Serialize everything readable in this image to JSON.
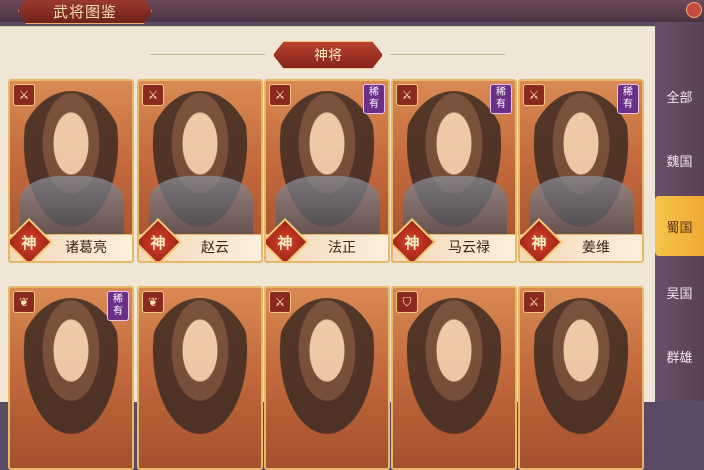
{
  "header": {
    "title": "武将图鉴"
  },
  "section": {
    "title": "神将"
  },
  "tabs": [
    {
      "label": "全部",
      "active": false
    },
    {
      "label": "魏国",
      "active": false
    },
    {
      "label": "蜀国",
      "active": true
    },
    {
      "label": "吴国",
      "active": false
    },
    {
      "label": "群雄",
      "active": false
    }
  ],
  "cards_row1": [
    {
      "name": "诸葛亮",
      "badge": "神",
      "rare": ""
    },
    {
      "name": "赵云",
      "badge": "神",
      "rare": ""
    },
    {
      "name": "法正",
      "badge": "神",
      "rare": "稀有"
    },
    {
      "name": "马云禄",
      "badge": "神",
      "rare": "稀有"
    },
    {
      "name": "姜维",
      "badge": "神",
      "rare": "稀有"
    }
  ],
  "cards_row2": [
    {
      "rare": "稀有"
    },
    {
      "rare": ""
    },
    {
      "rare": ""
    },
    {
      "rare": ""
    },
    {
      "rare": ""
    }
  ],
  "icons": {
    "corner": "weapon-icon",
    "close": "close-icon"
  },
  "colors": {
    "accent": "#f0a934",
    "card": "#c46a3c",
    "rare": "#6a2f86",
    "shen": "#d9432c"
  }
}
